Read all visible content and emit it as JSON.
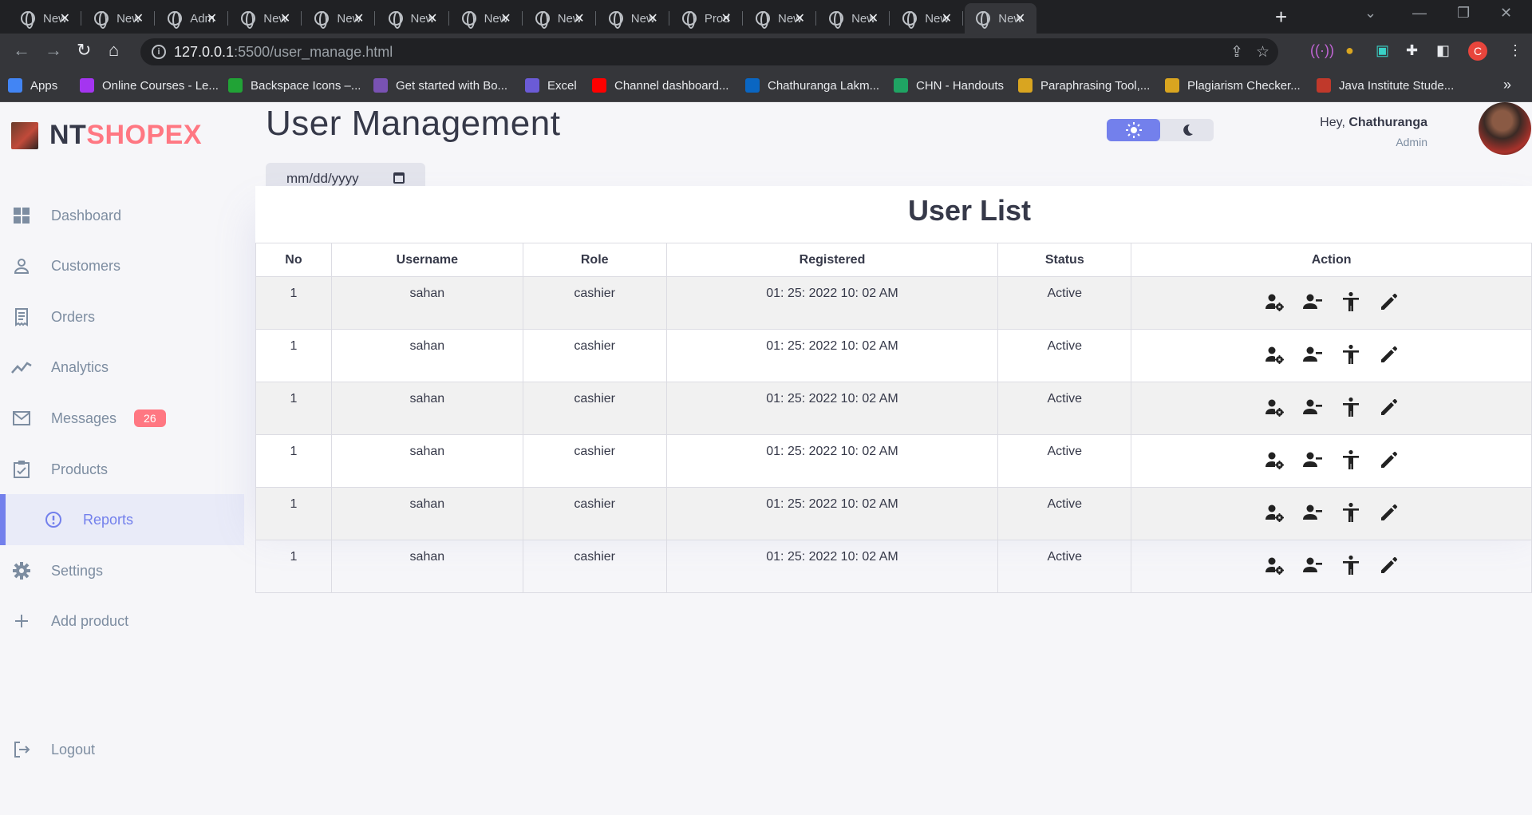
{
  "browser": {
    "tabs": [
      {
        "label": "New"
      },
      {
        "label": "New"
      },
      {
        "label": "Adm"
      },
      {
        "label": "New"
      },
      {
        "label": "New"
      },
      {
        "label": "New"
      },
      {
        "label": "New"
      },
      {
        "label": "New"
      },
      {
        "label": "New"
      },
      {
        "label": "Prod"
      },
      {
        "label": "New"
      },
      {
        "label": "New"
      },
      {
        "label": "New"
      },
      {
        "label": "New"
      }
    ],
    "active_tab_index": 13,
    "url_host": "127.0.0.1",
    "url_rest": ":5500/user_manage.html",
    "profile_initial": "C",
    "bookmarks": [
      {
        "label": "Apps",
        "icon": "apps-grid-icon",
        "color": "#4285f4"
      },
      {
        "label": "Online Courses - Le...",
        "icon": "udemy-icon",
        "color": "#a435f0"
      },
      {
        "label": "Backspace Icons –...",
        "icon": "backspace-icon",
        "color": "#21a336"
      },
      {
        "label": "Get started with Bo...",
        "icon": "bootstrap-icon",
        "color": "#7952b3"
      },
      {
        "label": "Excel",
        "icon": "excel-icon",
        "color": "#6b5bd6"
      },
      {
        "label": "Channel dashboard...",
        "icon": "youtube-icon",
        "color": "#ff0000"
      },
      {
        "label": "Chathuranga Lakm...",
        "icon": "linkedin-icon",
        "color": "#0a66c2"
      },
      {
        "label": "CHN - Handouts",
        "icon": "drive-icon",
        "color": "#1fa463"
      },
      {
        "label": "Paraphrasing Tool,...",
        "icon": "search-tool-icon",
        "color": "#d9a520"
      },
      {
        "label": "Plagiarism Checker...",
        "icon": "search-tool-icon",
        "color": "#d9a520"
      },
      {
        "label": "Java Institute Stude...",
        "icon": "java-icon",
        "color": "#c0392b"
      }
    ]
  },
  "brand": {
    "prefix": "NT",
    "suffix": "SHOPEX"
  },
  "sidebar": {
    "items": [
      {
        "label": "Dashboard",
        "icon": "dashboard-icon"
      },
      {
        "label": "Customers",
        "icon": "person-icon"
      },
      {
        "label": "Orders",
        "icon": "receipt-icon"
      },
      {
        "label": "Analytics",
        "icon": "analytics-icon"
      },
      {
        "label": "Messages",
        "icon": "mail-icon",
        "badge": "26"
      },
      {
        "label": "Products",
        "icon": "inventory-icon"
      },
      {
        "label": "Reports",
        "icon": "report-icon",
        "active": true
      },
      {
        "label": "Settings",
        "icon": "gear-icon"
      },
      {
        "label": "Add product",
        "icon": "plus-icon"
      }
    ],
    "logout": "Logout"
  },
  "header": {
    "title": "User Management",
    "date_placeholder": "mm/dd/yyyy",
    "greeting": "Hey, ",
    "user_name": "Chathuranga",
    "user_role": "Admin"
  },
  "colors": {
    "primary": "#7380ec",
    "danger": "#ff7782",
    "dark": "#363949",
    "info": "#7d8da1"
  },
  "user_list": {
    "title": "User List",
    "columns": [
      "No",
      "Username",
      "Role",
      "Registered",
      "Status",
      "Action"
    ],
    "rows": [
      {
        "no": "1",
        "username": "sahan",
        "role": "cashier",
        "registered": "01: 25: 2022 10: 02 AM",
        "status": "Active"
      },
      {
        "no": "1",
        "username": "sahan",
        "role": "cashier",
        "registered": "01: 25: 2022 10: 02 AM",
        "status": "Active"
      },
      {
        "no": "1",
        "username": "sahan",
        "role": "cashier",
        "registered": "01: 25: 2022 10: 02 AM",
        "status": "Active"
      },
      {
        "no": "1",
        "username": "sahan",
        "role": "cashier",
        "registered": "01: 25: 2022 10: 02 AM",
        "status": "Active"
      },
      {
        "no": "1",
        "username": "sahan",
        "role": "cashier",
        "registered": "01: 25: 2022 10: 02 AM",
        "status": "Active"
      },
      {
        "no": "1",
        "username": "sahan",
        "role": "cashier",
        "registered": "01: 25: 2022 10: 02 AM",
        "status": "Active"
      }
    ],
    "action_icons": [
      "manage-user-icon",
      "remove-user-icon",
      "accessibility-icon",
      "edit-pencil-icon"
    ]
  }
}
